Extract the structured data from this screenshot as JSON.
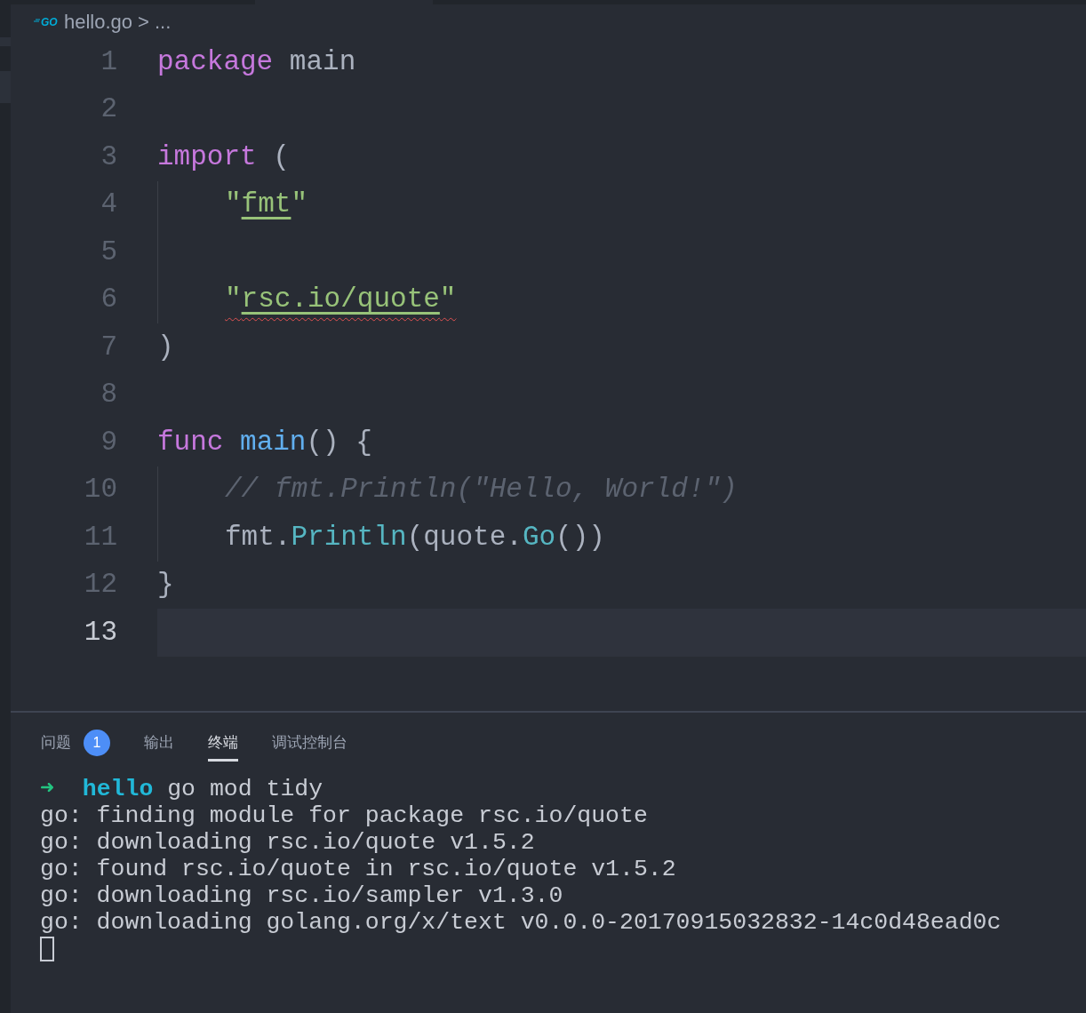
{
  "breadcrumb": {
    "file_icon": "GO",
    "file": "hello.go",
    "separator": ">",
    "more": "..."
  },
  "code_lines": [
    {
      "number": "1",
      "current": false,
      "tokens": [
        {
          "text": "package",
          "kind": "keyword"
        },
        {
          "text": " main",
          "kind": "plain"
        }
      ]
    },
    {
      "number": "2",
      "current": false
    },
    {
      "number": "3",
      "current": false,
      "tokens": [
        {
          "text": "import",
          "kind": "keyword"
        },
        {
          "text": " (",
          "kind": "plain"
        }
      ]
    },
    {
      "number": "4",
      "indented": true,
      "current": false,
      "tokens": [
        {
          "text": "\"",
          "kind": "string"
        },
        {
          "text": "fmt",
          "kind": "link"
        },
        {
          "text": "\"",
          "kind": "string"
        }
      ]
    },
    {
      "number": "5",
      "indented": true,
      "current": false
    },
    {
      "number": "6",
      "indented": true,
      "current": false,
      "error": true,
      "tokens": [
        {
          "text": "\"",
          "kind": "string"
        },
        {
          "text": "rsc.io/quote",
          "kind": "link"
        },
        {
          "text": "\"",
          "kind": "string"
        }
      ]
    },
    {
      "number": "7",
      "current": false,
      "tokens": [
        {
          "text": ")",
          "kind": "plain"
        }
      ]
    },
    {
      "number": "8",
      "current": false
    },
    {
      "number": "9",
      "current": false,
      "tokens": [
        {
          "text": "func",
          "kind": "keyword"
        },
        {
          "text": " main",
          "kind": "function"
        },
        {
          "text": "() {",
          "kind": "plain"
        }
      ]
    },
    {
      "number": "10",
      "indented": true,
      "current": false,
      "tokens": [
        {
          "text": "// fmt.Println(\"Hello, World!\")",
          "kind": "comment"
        }
      ]
    },
    {
      "number": "11",
      "indented": true,
      "current": false,
      "tokens": [
        {
          "text": "fmt.",
          "kind": "plain"
        },
        {
          "text": "Println",
          "kind": "method"
        },
        {
          "text": "(quote.",
          "kind": "plain"
        },
        {
          "text": "Go",
          "kind": "method"
        },
        {
          "text": "())",
          "kind": "plain"
        }
      ]
    },
    {
      "number": "12",
      "current": false,
      "tokens": [
        {
          "text": "}",
          "kind": "plain"
        }
      ]
    },
    {
      "number": "13",
      "current": true
    }
  ],
  "panel_tabs": [
    {
      "label": "问题",
      "selected": false,
      "badge": "1"
    },
    {
      "label": "输出",
      "selected": false
    },
    {
      "label": "终端",
      "selected": true
    },
    {
      "label": "调试控制台",
      "selected": false
    }
  ],
  "terminal": {
    "prompt": {
      "arrow": "➜",
      "directory": "hello",
      "command": "go mod tidy"
    },
    "lines": [
      "go: finding module for package rsc.io/quote",
      "go: downloading rsc.io/quote v1.5.2",
      "go: found rsc.io/quote in rsc.io/quote v1.5.2",
      "go: downloading rsc.io/sampler v1.3.0",
      "go: downloading golang.org/x/text v0.0.0-20170915032832-14c0d48ead0c"
    ]
  }
}
